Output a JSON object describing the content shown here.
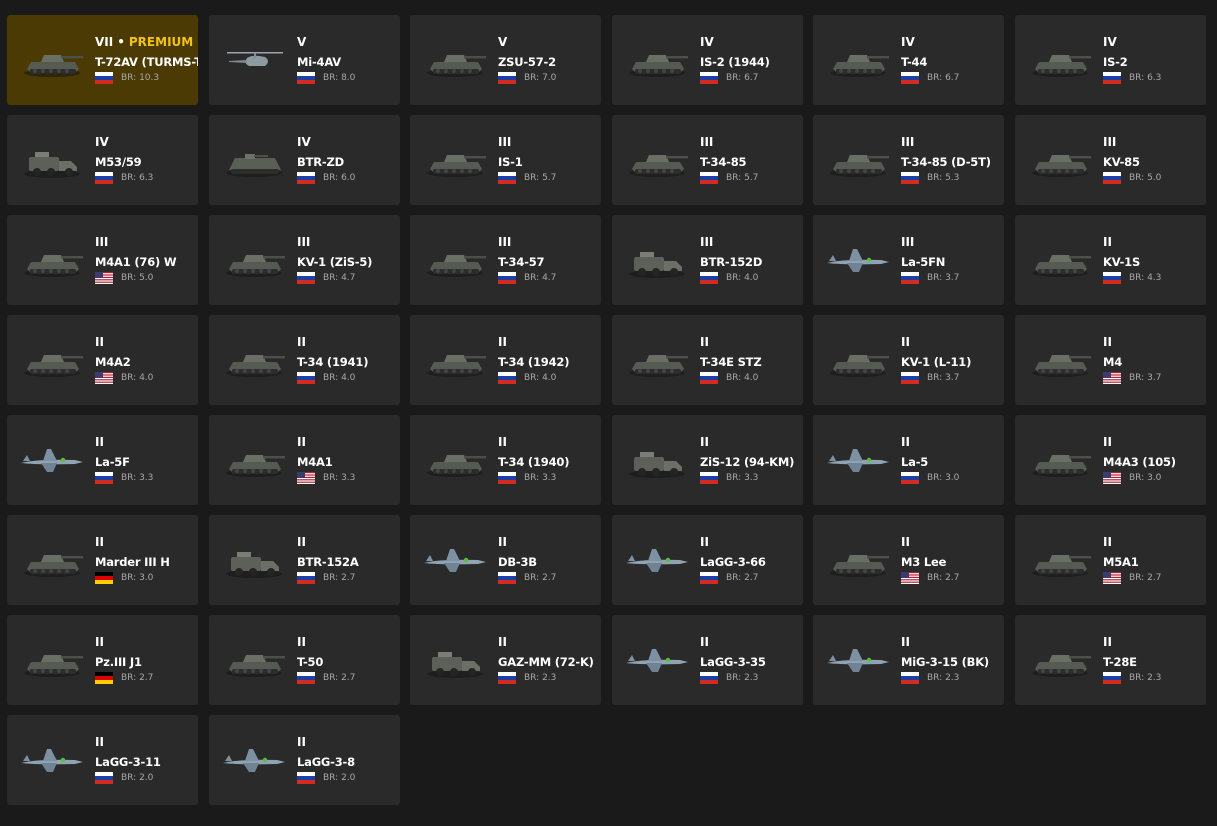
{
  "colors": {
    "background": "#1a1a1a",
    "card": "#2a2a2a",
    "premium_card": "#4b3a04",
    "premium_text": "#f2c21c",
    "br_text": "#a8a8a8"
  },
  "br_prefix": "BR:",
  "vehicles": [
    {
      "tier": "VII",
      "separator": "•",
      "premium_label": "PREMIUM",
      "premium": true,
      "name": "T-72AV (TURMS-T",
      "flag": "ussr",
      "flag_icon": "ussr-flag-icon",
      "br": "10.3",
      "thumb": "tank-icon"
    },
    {
      "tier": "V",
      "name": "Mi-4AV",
      "flag": "ussr",
      "flag_icon": "ussr-flag-icon",
      "br": "8.0",
      "thumb": "helicopter-icon"
    },
    {
      "tier": "V",
      "name": "ZSU-57-2",
      "flag": "ussr",
      "flag_icon": "ussr-flag-icon",
      "br": "7.0",
      "thumb": "tank-icon"
    },
    {
      "tier": "IV",
      "name": "IS-2 (1944)",
      "flag": "ussr",
      "flag_icon": "ussr-flag-icon",
      "br": "6.7",
      "thumb": "tank-icon"
    },
    {
      "tier": "IV",
      "name": "T-44",
      "flag": "ussr",
      "flag_icon": "ussr-flag-icon",
      "br": "6.7",
      "thumb": "tank-icon"
    },
    {
      "tier": "IV",
      "name": "IS-2",
      "flag": "ussr",
      "flag_icon": "ussr-flag-icon",
      "br": "6.3",
      "thumb": "tank-icon"
    },
    {
      "tier": "IV",
      "name": "M53/59",
      "flag": "ussr",
      "flag_icon": "ussr-flag-icon",
      "br": "6.3",
      "thumb": "truck-icon"
    },
    {
      "tier": "IV",
      "name": "BTR-ZD",
      "flag": "ussr",
      "flag_icon": "ussr-flag-icon",
      "br": "6.0",
      "thumb": "apc-icon"
    },
    {
      "tier": "III",
      "name": "IS-1",
      "flag": "ussr",
      "flag_icon": "ussr-flag-icon",
      "br": "5.7",
      "thumb": "tank-icon"
    },
    {
      "tier": "III",
      "name": "T-34-85",
      "flag": "ussr",
      "flag_icon": "ussr-flag-icon",
      "br": "5.7",
      "thumb": "tank-icon"
    },
    {
      "tier": "III",
      "name": "T-34-85 (D-5T)",
      "flag": "ussr",
      "flag_icon": "ussr-flag-icon",
      "br": "5.3",
      "thumb": "tank-icon"
    },
    {
      "tier": "III",
      "name": "KV-85",
      "flag": "ussr",
      "flag_icon": "ussr-flag-icon",
      "br": "5.0",
      "thumb": "tank-icon"
    },
    {
      "tier": "III",
      "name": "M4A1 (76) W",
      "flag": "usa",
      "flag_icon": "usa-flag-icon",
      "br": "5.0",
      "thumb": "tank-icon"
    },
    {
      "tier": "III",
      "name": "KV-1 (ZiS-5)",
      "flag": "ussr",
      "flag_icon": "ussr-flag-icon",
      "br": "4.7",
      "thumb": "tank-icon"
    },
    {
      "tier": "III",
      "name": "T-34-57",
      "flag": "ussr",
      "flag_icon": "ussr-flag-icon",
      "br": "4.7",
      "thumb": "tank-icon"
    },
    {
      "tier": "III",
      "name": "BTR-152D",
      "flag": "ussr",
      "flag_icon": "ussr-flag-icon",
      "br": "4.0",
      "thumb": "truck-icon"
    },
    {
      "tier": "III",
      "name": "La-5FN",
      "flag": "ussr",
      "flag_icon": "ussr-flag-icon",
      "br": "3.7",
      "thumb": "plane-icon"
    },
    {
      "tier": "II",
      "name": "KV-1S",
      "flag": "ussr",
      "flag_icon": "ussr-flag-icon",
      "br": "4.3",
      "thumb": "tank-icon"
    },
    {
      "tier": "II",
      "name": "M4A2",
      "flag": "usa",
      "flag_icon": "usa-flag-icon",
      "br": "4.0",
      "thumb": "tank-icon"
    },
    {
      "tier": "II",
      "name": "T-34 (1941)",
      "flag": "ussr",
      "flag_icon": "ussr-flag-icon",
      "br": "4.0",
      "thumb": "tank-icon"
    },
    {
      "tier": "II",
      "name": "T-34 (1942)",
      "flag": "ussr",
      "flag_icon": "ussr-flag-icon",
      "br": "4.0",
      "thumb": "tank-icon"
    },
    {
      "tier": "II",
      "name": "T-34E STZ",
      "flag": "ussr",
      "flag_icon": "ussr-flag-icon",
      "br": "4.0",
      "thumb": "tank-icon"
    },
    {
      "tier": "II",
      "name": "KV-1 (L-11)",
      "flag": "ussr",
      "flag_icon": "ussr-flag-icon",
      "br": "3.7",
      "thumb": "tank-icon"
    },
    {
      "tier": "II",
      "name": "M4",
      "flag": "usa",
      "flag_icon": "usa-flag-icon",
      "br": "3.7",
      "thumb": "tank-icon"
    },
    {
      "tier": "II",
      "name": "La-5F",
      "flag": "ussr",
      "flag_icon": "ussr-flag-icon",
      "br": "3.3",
      "thumb": "plane-icon"
    },
    {
      "tier": "II",
      "name": "M4A1",
      "flag": "usa",
      "flag_icon": "usa-flag-icon",
      "br": "3.3",
      "thumb": "tank-icon"
    },
    {
      "tier": "II",
      "name": "T-34 (1940)",
      "flag": "ussr",
      "flag_icon": "ussr-flag-icon",
      "br": "3.3",
      "thumb": "tank-icon"
    },
    {
      "tier": "II",
      "name": "ZiS-12 (94-KM)",
      "flag": "ussr",
      "flag_icon": "ussr-flag-icon",
      "br": "3.3",
      "thumb": "truck-icon"
    },
    {
      "tier": "II",
      "name": "La-5",
      "flag": "ussr",
      "flag_icon": "ussr-flag-icon",
      "br": "3.0",
      "thumb": "plane-icon"
    },
    {
      "tier": "II",
      "name": "M4A3 (105)",
      "flag": "usa",
      "flag_icon": "usa-flag-icon",
      "br": "3.0",
      "thumb": "tank-icon"
    },
    {
      "tier": "II",
      "name": "Marder III H",
      "flag": "germany",
      "flag_icon": "germany-flag-icon",
      "br": "3.0",
      "thumb": "tank-icon"
    },
    {
      "tier": "II",
      "name": "BTR-152A",
      "flag": "ussr",
      "flag_icon": "ussr-flag-icon",
      "br": "2.7",
      "thumb": "truck-icon"
    },
    {
      "tier": "II",
      "name": "DB-3B",
      "flag": "ussr",
      "flag_icon": "ussr-flag-icon",
      "br": "2.7",
      "thumb": "plane-icon"
    },
    {
      "tier": "II",
      "name": "LaGG-3-66",
      "flag": "ussr",
      "flag_icon": "ussr-flag-icon",
      "br": "2.7",
      "thumb": "plane-icon"
    },
    {
      "tier": "II",
      "name": "M3 Lee",
      "flag": "usa",
      "flag_icon": "usa-flag-icon",
      "br": "2.7",
      "thumb": "tank-icon"
    },
    {
      "tier": "II",
      "name": "M5A1",
      "flag": "usa",
      "flag_icon": "usa-flag-icon",
      "br": "2.7",
      "thumb": "tank-icon"
    },
    {
      "tier": "II",
      "name": "Pz.III J1",
      "flag": "germany",
      "flag_icon": "germany-flag-icon",
      "br": "2.7",
      "thumb": "tank-icon"
    },
    {
      "tier": "II",
      "name": "T-50",
      "flag": "ussr",
      "flag_icon": "ussr-flag-icon",
      "br": "2.7",
      "thumb": "tank-icon"
    },
    {
      "tier": "II",
      "name": "GAZ-MM (72-K)",
      "flag": "ussr",
      "flag_icon": "ussr-flag-icon",
      "br": "2.3",
      "thumb": "truck-icon"
    },
    {
      "tier": "II",
      "name": "LaGG-3-35",
      "flag": "ussr",
      "flag_icon": "ussr-flag-icon",
      "br": "2.3",
      "thumb": "plane-icon"
    },
    {
      "tier": "II",
      "name": "MiG-3-15 (BK)",
      "flag": "ussr",
      "flag_icon": "ussr-flag-icon",
      "br": "2.3",
      "thumb": "plane-icon"
    },
    {
      "tier": "II",
      "name": "T-28E",
      "flag": "ussr",
      "flag_icon": "ussr-flag-icon",
      "br": "2.3",
      "thumb": "tank-icon"
    },
    {
      "tier": "II",
      "name": "LaGG-3-11",
      "flag": "ussr",
      "flag_icon": "ussr-flag-icon",
      "br": "2.0",
      "thumb": "plane-icon"
    },
    {
      "tier": "II",
      "name": "LaGG-3-8",
      "flag": "ussr",
      "flag_icon": "ussr-flag-icon",
      "br": "2.0",
      "thumb": "plane-icon"
    }
  ]
}
